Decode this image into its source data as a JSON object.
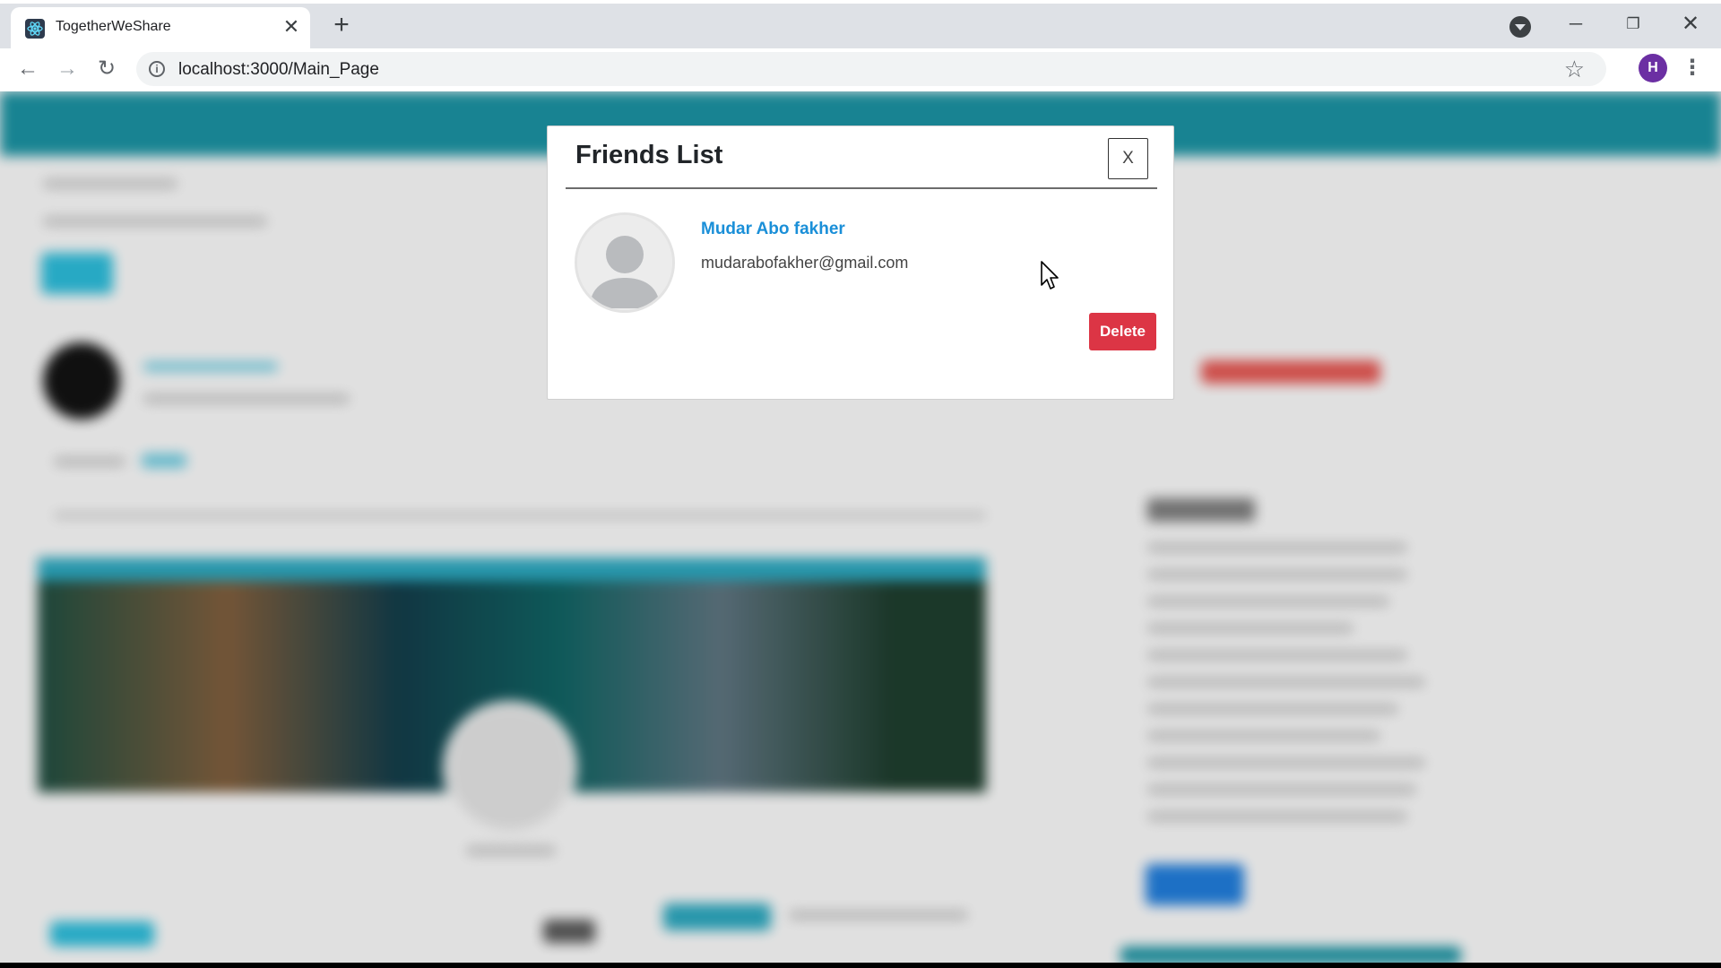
{
  "browser": {
    "tab_title": "TogetherWeShare",
    "tab_close": "✕",
    "new_tab": "+",
    "url": "localhost:3000/Main_Page",
    "profile_initial": "H",
    "window_minimize": "─",
    "window_restore": "❐",
    "window_close": "✕",
    "star": "☆",
    "kebab": "⋮",
    "back": "←",
    "forward": "→",
    "reload": "↻",
    "info": "i"
  },
  "modal": {
    "title": "Friends List",
    "close_label": "X",
    "friends": [
      {
        "name": "Mudar Abo fakher",
        "email": "mudarabofakher@gmail.com",
        "delete_label": "Delete"
      }
    ]
  },
  "colors": {
    "navbar": "#1a8b9a",
    "friend_name": "#1a8fd8",
    "delete_button": "#dc3545",
    "profile_avatar": "#6b2fa3"
  }
}
